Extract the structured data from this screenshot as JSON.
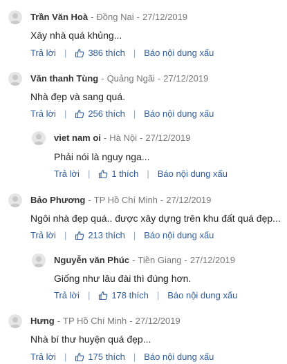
{
  "ui": {
    "reply_label": "Trả lời",
    "report_label": "Báo nội dung xấu",
    "separator": "-",
    "pipe": "|"
  },
  "comments": [
    {
      "author": "Trần Văn Hoà",
      "location": "Đồng Nai",
      "date": "27/12/2019",
      "text": "Xây nhà quá khủng...",
      "likes": "386 thích"
    },
    {
      "author": "Văn thanh Tùng",
      "location": "Quảng Ngãi",
      "date": "27/12/2019",
      "text": "Nhà đẹp và sang quá.",
      "likes": "256 thích"
    },
    {
      "author": "viet nam oi",
      "location": "Hà Nội",
      "date": "27/12/2019",
      "text": "Phải nói là nguy nga...",
      "likes": "1 thích"
    },
    {
      "author": "Bảo Phương",
      "location": "TP Hồ Chí Minh",
      "date": "27/12/2019",
      "text": "Ngôi nhà đẹp quá.. được xây dựng trên khu đất quá đẹp...",
      "likes": "213 thích"
    },
    {
      "author": "Nguyễn văn Phúc",
      "location": "Tiền Giang",
      "date": "27/12/2019",
      "text": "Giống như lâu đài thì đúng hơn.",
      "likes": "178 thích"
    },
    {
      "author": "Hưng",
      "location": "TP Hồ Chí Minh",
      "date": "27/12/2019",
      "text": "Nhà bí thư huyện quá đẹp...",
      "likes": "175 thích"
    }
  ]
}
